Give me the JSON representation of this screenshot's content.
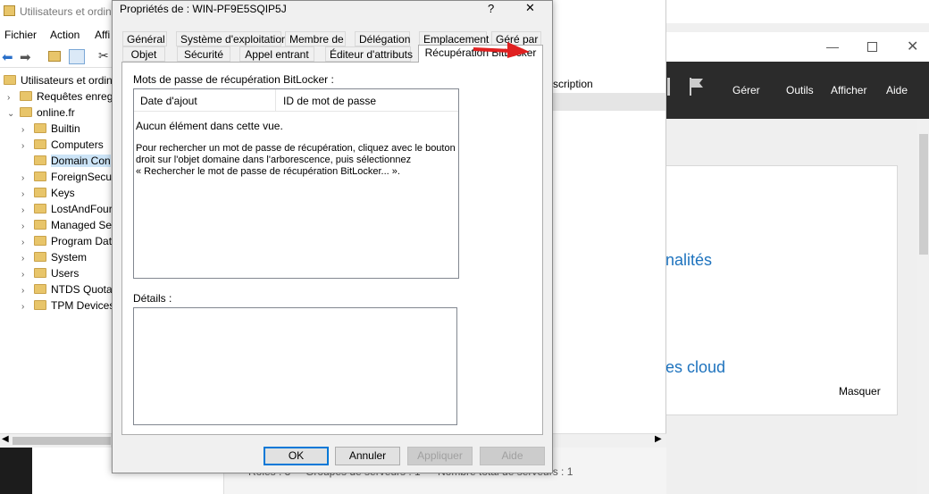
{
  "aduc": {
    "title": "Utilisateurs et ordin",
    "menu": [
      "Fichier",
      "Action",
      "Affi"
    ],
    "tree": [
      {
        "label": "Utilisateurs et ordina",
        "level": 0,
        "chev": ""
      },
      {
        "label": "Requêtes enregi",
        "level": 1,
        "chev": ">"
      },
      {
        "label": "online.fr",
        "level": 1,
        "chev": "v"
      },
      {
        "label": "Builtin",
        "level": 2,
        "chev": ">"
      },
      {
        "label": "Computers",
        "level": 2,
        "chev": ">"
      },
      {
        "label": "Domain Con",
        "level": 2,
        "chev": "",
        "selected": true
      },
      {
        "label": "ForeignSecur",
        "level": 2,
        "chev": ">"
      },
      {
        "label": "Keys",
        "level": 2,
        "chev": ">"
      },
      {
        "label": "LostAndFour",
        "level": 2,
        "chev": ">"
      },
      {
        "label": "Managed Se",
        "level": 2,
        "chev": ">"
      },
      {
        "label": "Program Dat",
        "level": 2,
        "chev": ">"
      },
      {
        "label": "System",
        "level": 2,
        "chev": ">"
      },
      {
        "label": "Users",
        "level": 2,
        "chev": ">"
      },
      {
        "label": "NTDS Quota",
        "level": 2,
        "chev": ">"
      },
      {
        "label": "TPM Devices",
        "level": 2,
        "chev": ">"
      }
    ],
    "right_header": "scription"
  },
  "server_manager": {
    "menu": [
      "Gérer",
      "Outils",
      "Afficher",
      "Aide"
    ],
    "link1": "nalités",
    "link2": "es cloud",
    "hide": "Masquer",
    "lower1": "Rôles : 3",
    "lower2": "Groupes de serveurs : 1",
    "lower3": "Nombre total de serveurs : 1"
  },
  "dialog": {
    "title": "Propriétés de : WIN-PF9E5SQIP5J",
    "help": "?",
    "close": "✕",
    "tabs_row1": [
      "Général",
      "Système d'exploitation",
      "Membre de",
      "Délégation",
      "Emplacement",
      "Géré par"
    ],
    "tabs_row2": [
      "Objet",
      "Sécurité",
      "Appel entrant",
      "Éditeur d'attributs",
      "Récupération BitLocker"
    ],
    "group_label": "Mots de passe de récupération BitLocker :",
    "columns": [
      "Date d'ajout",
      "ID de mot de passe"
    ],
    "empty": "Aucun élément dans cette vue.",
    "hint_lines": [
      "Pour rechercher un mot de passe de récupération, cliquez avec le bouton",
      "droit sur l'objet domaine dans l'arborescence, puis sélectionnez",
      "« Rechercher le mot de passe de récupération BitLocker... »."
    ],
    "details_label": "Détails :",
    "buttons": {
      "ok": "OK",
      "cancel": "Annuler",
      "apply": "Appliquer",
      "help": "Aide"
    }
  },
  "colors": {
    "arrow": "#e02020",
    "accent": "#0078d7",
    "sm_header": "#2b2b2b"
  }
}
